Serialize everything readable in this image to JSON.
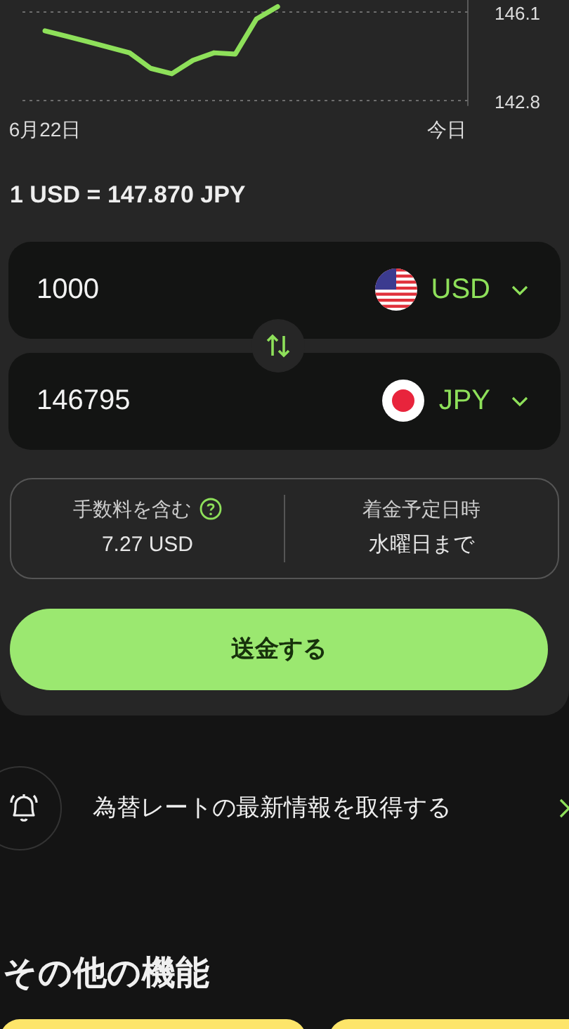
{
  "chart_data": {
    "type": "line",
    "categories": [
      "6月22日",
      null,
      null,
      null,
      null,
      null,
      null,
      null,
      null,
      null,
      null,
      null,
      null,
      null,
      null,
      null,
      null,
      null,
      null,
      "今日"
    ],
    "yticks": [
      142.8,
      146.1
    ],
    "ylim": [
      142.6,
      146.6
    ],
    "series": [
      {
        "color": "#8ee05a",
        "values": [
          145.4,
          145.2,
          145.0,
          144.79,
          144.58,
          144.0,
          143.8,
          144.3,
          144.58,
          144.53,
          145.84,
          146.3,
          null,
          null,
          null,
          null,
          null,
          null,
          null,
          null
        ]
      }
    ]
  },
  "rate": "1 USD = 147.870 JPY",
  "amounts": [
    {
      "value": "1000",
      "currency": "USD",
      "kind": "us"
    },
    {
      "value": "146795",
      "currency": "JPY",
      "kind": "jp"
    }
  ],
  "fee": {
    "label": "手数料を含む",
    "value": "7.27 USD"
  },
  "arrival": {
    "label": "着金予定日時",
    "value": "水曜日まで"
  },
  "send_button": "送金する",
  "alert_link": "為替レートの最新情報を取得する",
  "section_title": "その他の機能",
  "feature_cards": [
    {
      "kind": "card"
    },
    {
      "kind": "card"
    }
  ]
}
